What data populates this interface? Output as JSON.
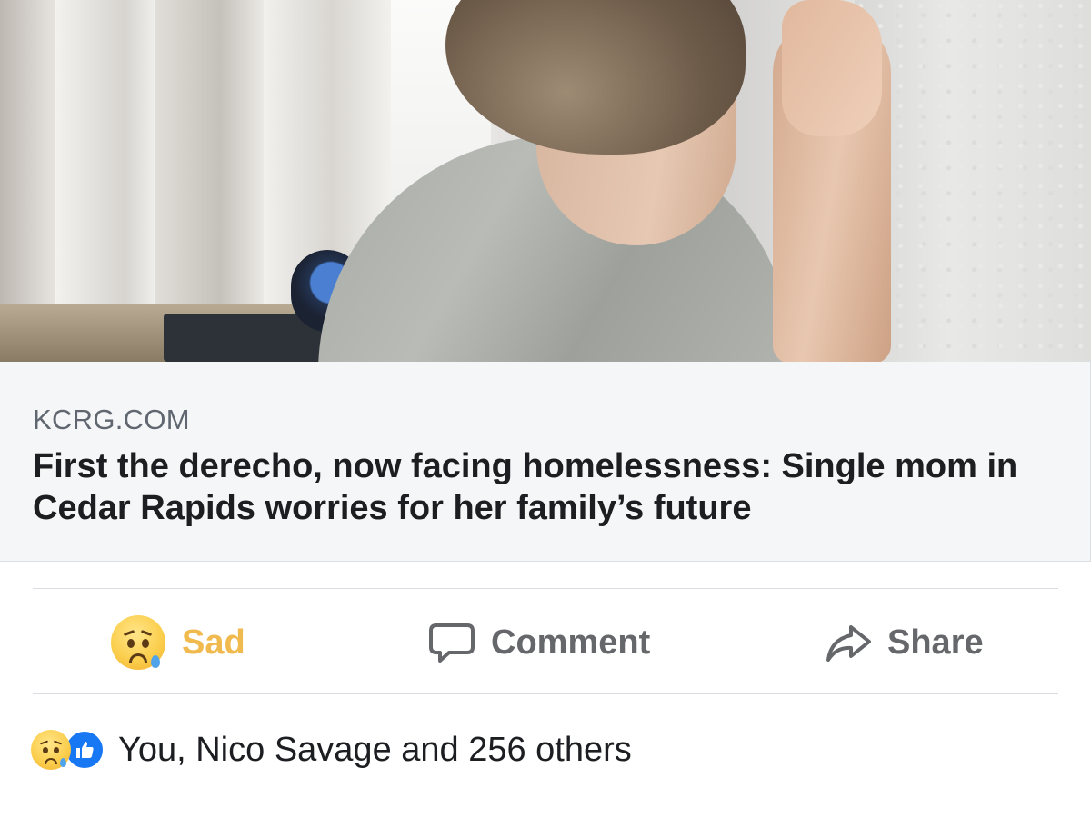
{
  "post": {
    "link_preview": {
      "domain": "KCRG.COM",
      "headline": "First the derecho, now facing homelessness: Single mom in Cedar Rapids worries for her family’s future"
    },
    "actions": {
      "sad_label": "Sad",
      "comment_label": "Comment",
      "share_label": "Share"
    },
    "reactions_summary": {
      "text": "You, Nico Savage and 256 others",
      "icons": [
        "sad-emoji",
        "like-icon"
      ]
    }
  },
  "colors": {
    "sad_accent": "#f0ba4e",
    "action_gray": "#65676b",
    "like_blue": "#1877f2",
    "link_bg": "#f5f6f7"
  }
}
